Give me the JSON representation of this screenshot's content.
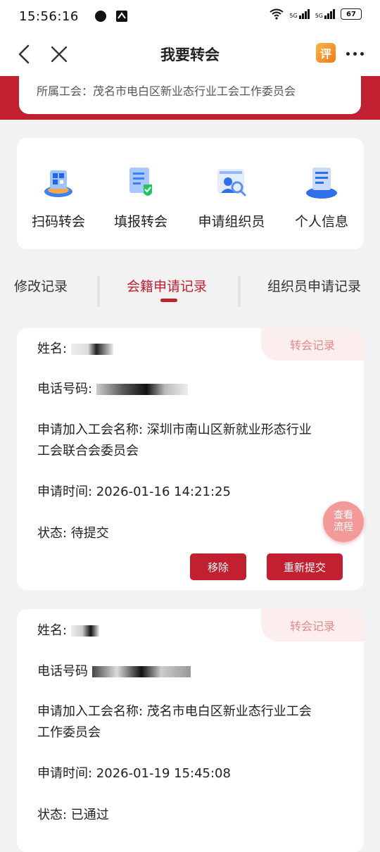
{
  "status_bar": {
    "time": "15:56:16",
    "network_1": "5G",
    "network_2": "5G",
    "battery": "67"
  },
  "nav": {
    "title": "我要转会",
    "rate_glyph": "评"
  },
  "union": {
    "text": "所属工会：茂名市电白区新业态行业工会工作委员会"
  },
  "menu": [
    {
      "label": "扫码转会",
      "icon": "qr-scan-icon"
    },
    {
      "label": "填报转会",
      "icon": "form-check-icon"
    },
    {
      "label": "申请组织员",
      "icon": "person-search-icon"
    },
    {
      "label": "个人信息",
      "icon": "profile-card-icon"
    }
  ],
  "tabs": [
    {
      "label": "修改记录",
      "active": false
    },
    {
      "label": "会籍申请记录",
      "active": true
    },
    {
      "label": "组织员申请记录",
      "active": false
    }
  ],
  "records": [
    {
      "tag": "转会记录",
      "name_label": "姓名:",
      "phone_label": "电话号码:",
      "union_name": "申请加入工会名称: 深圳市南山区新就业形态行业",
      "union_name_2": "工会联合会委员会",
      "time": "申请时间: 2026-01-16 14:21:25",
      "status": "状态: 待提交",
      "btn_remove": "移除",
      "btn_resubmit": "重新提交"
    },
    {
      "tag": "转会记录",
      "name_label": "姓名:",
      "phone_label": "电话号码",
      "union_name": "申请加入工会名称: 茂名市电白区新业态行业工会",
      "union_name_2": "工作委员会",
      "time": "申请时间: 2026-01-19 15:45:08",
      "status": "状态: 已通过"
    }
  ],
  "float_button": {
    "line1": "查看",
    "line2": "流程"
  },
  "colors": {
    "brand_red": "#c0202f",
    "tag_bg": "#fdeeee",
    "float_pink": "#f29a9a"
  }
}
